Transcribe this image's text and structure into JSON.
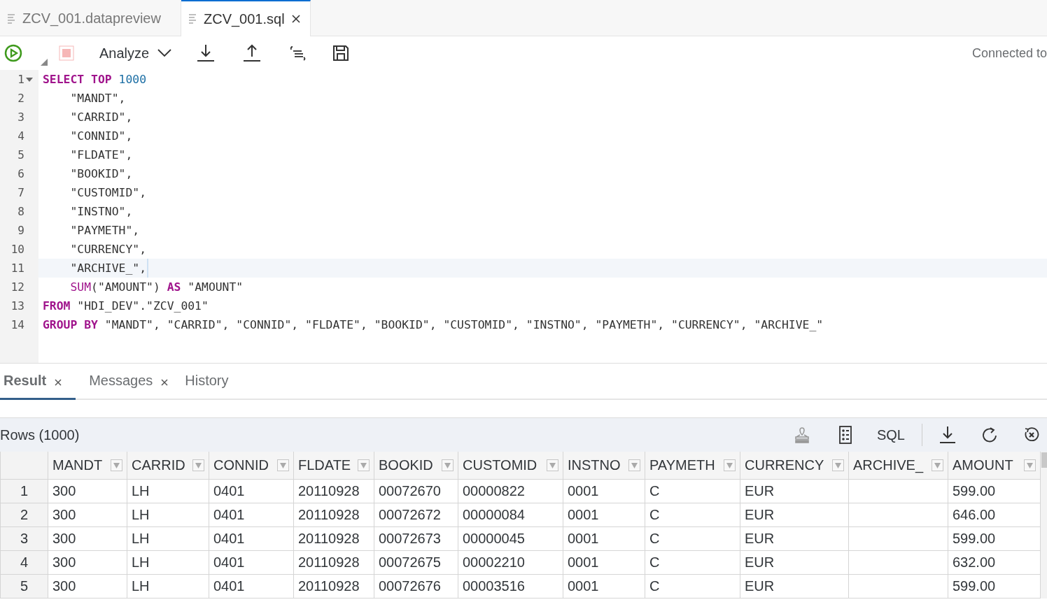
{
  "editor_tabs": [
    {
      "label": "ZCV_001.datapreview",
      "selected": false,
      "closable": false
    },
    {
      "label": "ZCV_001.sql",
      "selected": true,
      "closable": true
    }
  ],
  "toolbar": {
    "run_disabled": false,
    "stop_disabled": true,
    "analyze_label": "Analyze",
    "connection": "Connected to"
  },
  "editor": {
    "lines": [
      {
        "number": "1",
        "foldable": true,
        "current": false,
        "indented": false,
        "tokens": [
          {
            "kind": "keyword",
            "text": "SELECT"
          },
          {
            "kind": "keyword",
            "text": "TOP"
          },
          {
            "kind": "number",
            "text": "1000"
          }
        ]
      },
      {
        "number": "2",
        "foldable": false,
        "current": false,
        "indented": true,
        "tokens": [
          {
            "kind": "plain",
            "text": "\"MANDT\","
          }
        ]
      },
      {
        "number": "3",
        "foldable": false,
        "current": false,
        "indented": true,
        "tokens": [
          {
            "kind": "plain",
            "text": "\"CARRID\","
          }
        ]
      },
      {
        "number": "4",
        "foldable": false,
        "current": false,
        "indented": true,
        "tokens": [
          {
            "kind": "plain",
            "text": "\"CONNID\","
          }
        ]
      },
      {
        "number": "5",
        "foldable": false,
        "current": false,
        "indented": true,
        "tokens": [
          {
            "kind": "plain",
            "text": "\"FLDATE\","
          }
        ]
      },
      {
        "number": "6",
        "foldable": false,
        "current": false,
        "indented": true,
        "tokens": [
          {
            "kind": "plain",
            "text": "\"BOOKID\","
          }
        ]
      },
      {
        "number": "7",
        "foldable": false,
        "current": false,
        "indented": true,
        "tokens": [
          {
            "kind": "plain",
            "text": "\"CUSTOMID\","
          }
        ]
      },
      {
        "number": "8",
        "foldable": false,
        "current": false,
        "indented": true,
        "tokens": [
          {
            "kind": "plain",
            "text": "\"INSTNO\","
          }
        ]
      },
      {
        "number": "9",
        "foldable": false,
        "current": false,
        "indented": true,
        "tokens": [
          {
            "kind": "plain",
            "text": "\"PAYMETH\","
          }
        ]
      },
      {
        "number": "10",
        "foldable": false,
        "current": false,
        "indented": true,
        "tokens": [
          {
            "kind": "plain",
            "text": "\"CURRENCY\","
          }
        ]
      },
      {
        "number": "11",
        "foldable": false,
        "current": true,
        "indented": true,
        "tokens": [
          {
            "kind": "plain",
            "text": "\"ARCHIVE_\","
          }
        ]
      },
      {
        "number": "12",
        "foldable": false,
        "current": false,
        "indented": true,
        "tokens": [
          {
            "kind": "function",
            "text": "SUM"
          },
          {
            "kind": "plain",
            "text": "(\"AMOUNT\")",
            "join": true
          },
          {
            "kind": "keyword",
            "text": "AS"
          },
          {
            "kind": "plain",
            "text": "\"AMOUNT\""
          }
        ]
      },
      {
        "number": "13",
        "foldable": false,
        "current": false,
        "indented": false,
        "tokens": [
          {
            "kind": "keyword",
            "text": "FROM"
          },
          {
            "kind": "plain",
            "text": "\"HDI_DEV\".\"ZCV_001\""
          }
        ]
      },
      {
        "number": "14",
        "foldable": false,
        "current": false,
        "indented": false,
        "tokens": [
          {
            "kind": "keyword",
            "text": "GROUP"
          },
          {
            "kind": "keyword",
            "text": "BY"
          },
          {
            "kind": "plain",
            "text": "\"MANDT\", \"CARRID\", \"CONNID\", \"FLDATE\", \"BOOKID\", \"CUSTOMID\", \"INSTNO\", \"PAYMETH\", \"CURRENCY\", \"ARCHIVE_\""
          }
        ]
      }
    ]
  },
  "result_tabs": [
    {
      "label": "Result",
      "selected": true,
      "closable": true
    },
    {
      "label": "Messages",
      "selected": false,
      "closable": true
    },
    {
      "label": "History",
      "selected": false,
      "closable": false
    }
  ],
  "result": {
    "rows_label": "Rows (1000)",
    "sql_button": "SQL",
    "columns": [
      "MANDT",
      "CARRID",
      "CONNID",
      "FLDATE",
      "BOOKID",
      "CUSTOMID",
      "INSTNO",
      "PAYMETH",
      "CURRENCY",
      "ARCHIVE_",
      "AMOUNT"
    ],
    "rows": [
      {
        "number": "1",
        "cells": [
          "300",
          "LH",
          "0401",
          "20110928",
          "00072670",
          "00000822",
          "0001",
          "C",
          "EUR",
          null,
          "599.00"
        ]
      },
      {
        "number": "2",
        "cells": [
          "300",
          "LH",
          "0401",
          "20110928",
          "00072672",
          "00000084",
          "0001",
          "C",
          "EUR",
          null,
          "646.00"
        ]
      },
      {
        "number": "3",
        "cells": [
          "300",
          "LH",
          "0401",
          "20110928",
          "00072673",
          "00000045",
          "0001",
          "C",
          "EUR",
          null,
          "599.00"
        ]
      },
      {
        "number": "4",
        "cells": [
          "300",
          "LH",
          "0401",
          "20110928",
          "00072675",
          "00002210",
          "0001",
          "C",
          "EUR",
          null,
          "632.00"
        ]
      },
      {
        "number": "5",
        "cells": [
          "300",
          "LH",
          "0401",
          "20110928",
          "00072676",
          "00003516",
          "0001",
          "C",
          "EUR",
          null,
          "599.00"
        ]
      }
    ]
  }
}
